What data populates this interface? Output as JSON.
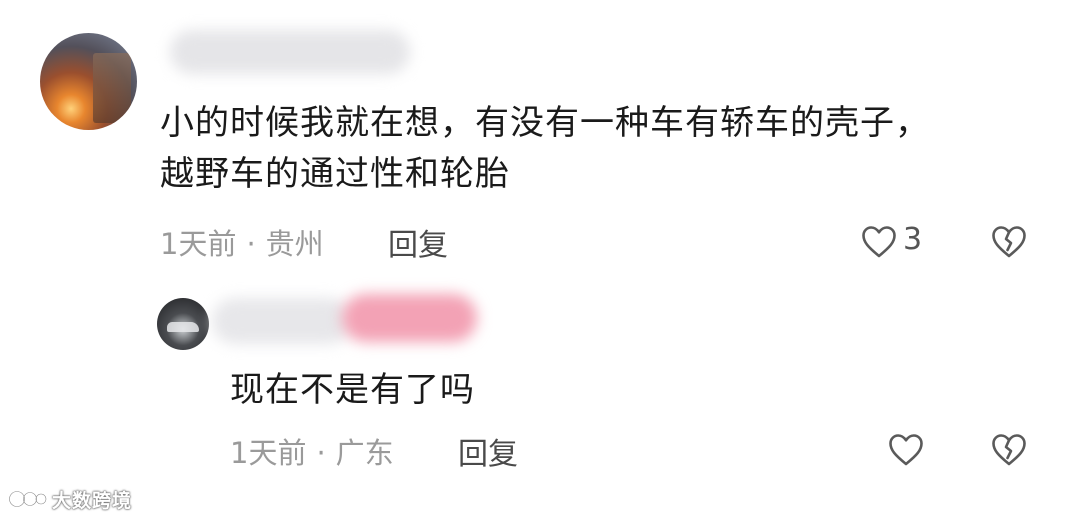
{
  "comment": {
    "text_line1": "小的时候我就在想，有没有一种车有轿车的壳子，",
    "text_line2": "越野车的通过性和轮胎",
    "time": "1天前",
    "separator": "·",
    "location": "贵州",
    "reply_label": "回复",
    "like_count": "3",
    "like_icon": "heart-outline-icon",
    "dislike_icon": "broken-heart-icon"
  },
  "reply": {
    "text": "现在不是有了吗",
    "time": "1天前",
    "separator": "·",
    "location": "广东",
    "reply_label": "回复",
    "like_icon": "heart-outline-icon",
    "dislike_icon": "broken-heart-icon"
  },
  "watermark": {
    "text": "大数跨境"
  },
  "colors": {
    "text_primary": "#1a1a1a",
    "text_meta": "#9a9a9a",
    "icon": "#5a5a5a",
    "blur_pink": "#f3a2b5"
  }
}
